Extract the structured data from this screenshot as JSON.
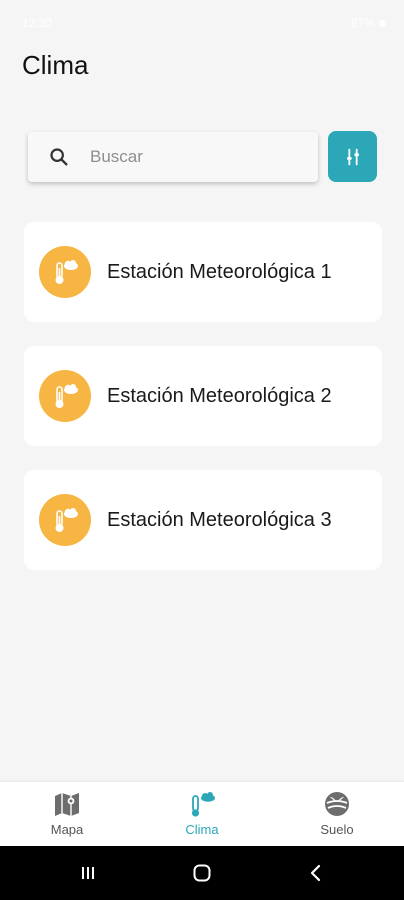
{
  "status_bar": {
    "time": "12:30",
    "battery": "87%"
  },
  "page": {
    "title": "Clima"
  },
  "search": {
    "placeholder": "Buscar",
    "value": ""
  },
  "filter_button": {
    "icon": "sliders-icon"
  },
  "stations": [
    {
      "label": "Estación Meteorológica 1",
      "icon": "thermometer-cloud-icon"
    },
    {
      "label": "Estación Meteorológica 2",
      "icon": "thermometer-cloud-icon"
    },
    {
      "label": "Estación Meteorológica 3",
      "icon": "thermometer-cloud-icon"
    }
  ],
  "bottom_nav": {
    "items": [
      {
        "label": "Mapa",
        "icon": "map-icon",
        "active": false
      },
      {
        "label": "Clima",
        "icon": "thermometer-cloud-icon",
        "active": true
      },
      {
        "label": "Suelo",
        "icon": "soil-sprout-icon",
        "active": false
      }
    ]
  },
  "colors": {
    "accent": "#2ba7b8",
    "station_icon_bg": "#f7b543",
    "background": "#f5f5f5"
  }
}
